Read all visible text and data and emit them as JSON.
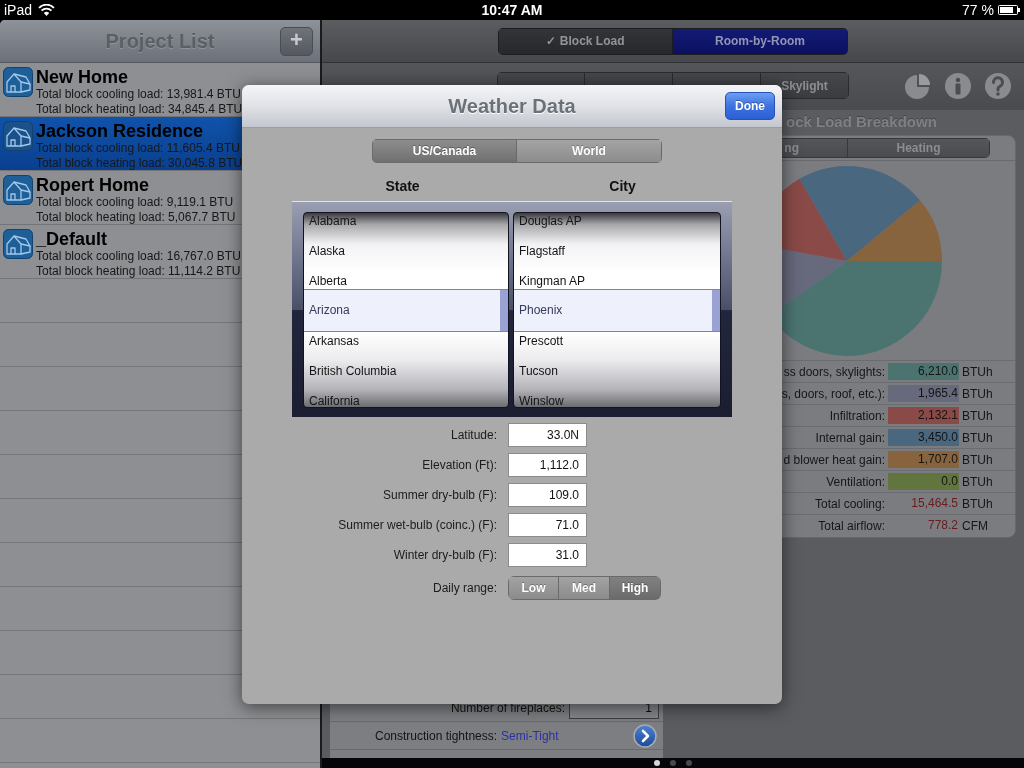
{
  "status_bar": {
    "device": "iPad",
    "time": "10:47 AM",
    "battery": "77 %"
  },
  "project_list": {
    "title": "Project List",
    "add_button": "+",
    "items": [
      {
        "name": "New Home",
        "cooling": "Total block cooling load: 13,981.4 BTU",
        "heating": "Total block heating load: 34,845.4 BTU",
        "selected": false
      },
      {
        "name": "Jackson Residence",
        "cooling": "Total block cooling load: 11,605.4 BTU",
        "heating": "Total block heating load: 30,045.8 BTU",
        "selected": true
      },
      {
        "name": "Ropert Home",
        "cooling": "Total block cooling load: 9,119.1 BTU",
        "heating": "Total block heating load: 5,067.7 BTU",
        "selected": false
      },
      {
        "name": "_Default",
        "cooling": "Total block cooling load: 16,767.0 BTU",
        "heating": "Total block heating load: 11,114.2 BTU",
        "selected": false
      }
    ]
  },
  "mode_tabs": [
    {
      "label": "✓ Block Load",
      "selected": false
    },
    {
      "label": "Room-by-Room",
      "selected": true
    }
  ],
  "section_tabs": [
    {
      "kind": "covered"
    },
    {
      "kind": "covered"
    },
    {
      "kind": "covered"
    },
    {
      "kind": "labeled",
      "label": "Skylight"
    }
  ],
  "breakdown": {
    "title": "ock Load Breakdown",
    "tabs": [
      {
        "label": "ng"
      },
      {
        "label": "Heating"
      }
    ],
    "chart_data": {
      "type": "pie",
      "values": [
        40.16,
        12.71,
        13.79,
        22.31,
        11.03
      ]
    },
    "rows": [
      {
        "kind": "swatch",
        "label": "ss doors, skylights:",
        "value": "6,210.0",
        "unit": "BTUh",
        "color": "#4b7471"
      },
      {
        "kind": "swatch",
        "label": "s, doors, roof, etc.):",
        "value": "1,965.4",
        "unit": "BTUh",
        "color": "#67697c"
      },
      {
        "kind": "swatch",
        "label": "Infiltration:",
        "value": "2,132.1",
        "unit": "BTUh",
        "color": "#8a4a47"
      },
      {
        "kind": "swatch",
        "label": "Internal gain:",
        "value": "3,450.0",
        "unit": "BTUh",
        "color": "#4a6780"
      },
      {
        "kind": "swatch",
        "label": "d blower heat gain:",
        "value": "1,707.0",
        "unit": "BTUh",
        "color": "#87643d"
      },
      {
        "kind": "swatch",
        "label": "Ventilation:",
        "value": "0.0",
        "unit": "BTUh",
        "color": "#62753f"
      },
      {
        "kind": "total",
        "label": "Total cooling:",
        "value": "15,464.5",
        "unit": "BTUh"
      },
      {
        "kind": "total",
        "label": "Total airflow:",
        "value": "778.2",
        "unit": "CFM"
      }
    ]
  },
  "settings": [
    {
      "kind": "number",
      "label": "Number of fireplaces:",
      "value": "1"
    },
    {
      "kind": "choice",
      "label": "Construction tightness:",
      "value": "Semi-Tight"
    }
  ],
  "page_dots": [
    {
      "selected": true
    },
    {
      "selected": false
    },
    {
      "selected": false
    }
  ],
  "weather_dialog": {
    "title": "Weather Data",
    "done_button": "Done",
    "region_tabs": [
      {
        "label": "US/Canada",
        "selected": true
      },
      {
        "label": "World",
        "selected": false
      }
    ],
    "picker": {
      "columns": [
        {
          "heading": "State",
          "options": [
            {
              "label": "Alabama",
              "selected": false
            },
            {
              "label": "Alaska",
              "selected": false
            },
            {
              "label": "Alberta",
              "selected": false
            },
            {
              "label": "Arizona",
              "selected": true
            },
            {
              "label": "Arkansas",
              "selected": false
            },
            {
              "label": "British Columbia",
              "selected": false
            },
            {
              "label": "California",
              "selected": false
            }
          ]
        },
        {
          "heading": "City",
          "options": [
            {
              "label": "Douglas AP",
              "selected": false
            },
            {
              "label": "Flagstaff",
              "selected": false
            },
            {
              "label": "Kingman AP",
              "selected": false
            },
            {
              "label": "Phoenix",
              "selected": true
            },
            {
              "label": "Prescott",
              "selected": false
            },
            {
              "label": "Tucson",
              "selected": false
            },
            {
              "label": "Winslow",
              "selected": false
            }
          ]
        }
      ]
    },
    "fields": [
      {
        "label": "Latitude:",
        "value": "33.0N"
      },
      {
        "label": "Elevation (Ft):",
        "value": "1,112.0"
      },
      {
        "label": "Summer dry-bulb (F):",
        "value": "109.0"
      },
      {
        "label": "Summer wet-bulb (coinc.) (F):",
        "value": "71.0"
      },
      {
        "label": "Winter dry-bulb (F):",
        "value": "31.0"
      }
    ],
    "daily_range": {
      "label": "Daily range:",
      "options": [
        {
          "label": "Low",
          "selected": false
        },
        {
          "label": "Med",
          "selected": false
        },
        {
          "label": "High",
          "selected": true
        }
      ]
    }
  }
}
